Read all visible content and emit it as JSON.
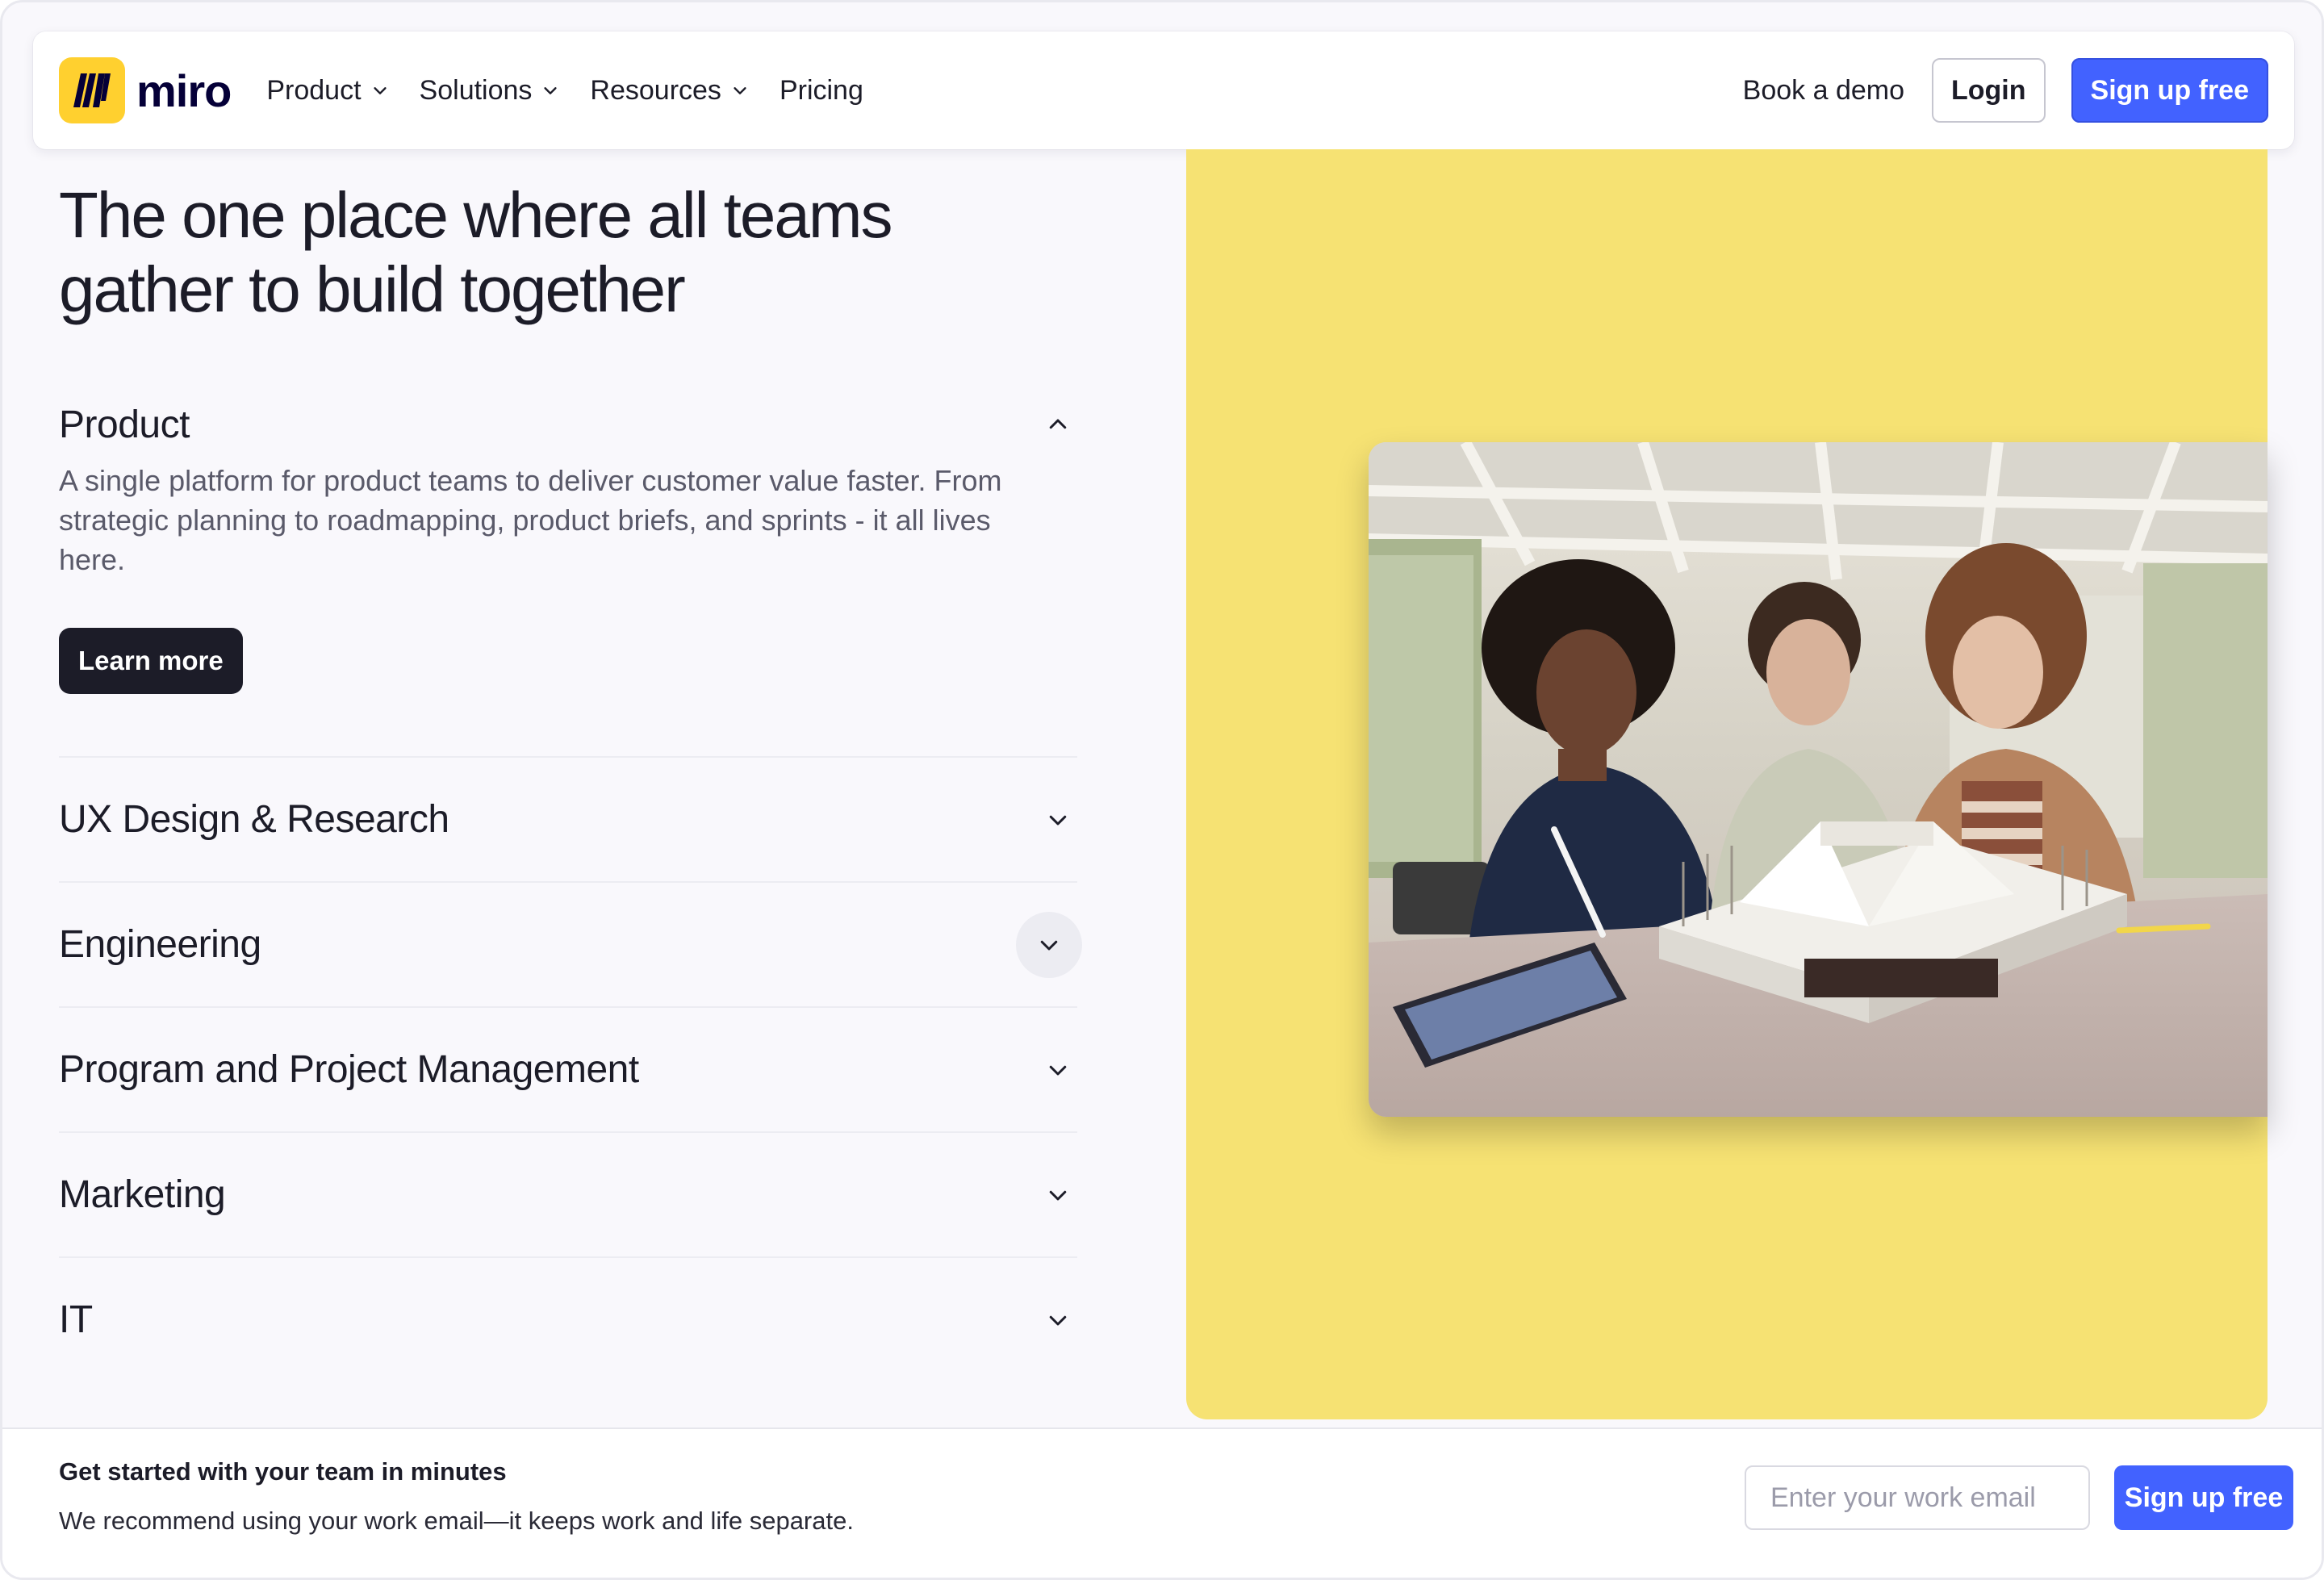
{
  "nav": {
    "logo_text": "miro",
    "links": [
      {
        "label": "Product",
        "has_dropdown": true
      },
      {
        "label": "Solutions",
        "has_dropdown": true
      },
      {
        "label": "Resources",
        "has_dropdown": true
      },
      {
        "label": "Pricing",
        "has_dropdown": false
      }
    ],
    "book_demo": "Book a demo",
    "login": "Login",
    "signup": "Sign up free"
  },
  "hero": {
    "title": "The one place where all teams gather to build together",
    "accordion": [
      {
        "title": "Product",
        "expanded": true,
        "description": "A single platform for product teams to deliver customer value faster. From strategic planning to roadmapping, product briefs, and sprints - it all lives here.",
        "button": "Learn more"
      },
      {
        "title": "UX Design & Research",
        "expanded": false
      },
      {
        "title": "Engineering",
        "expanded": false,
        "hovered": true
      },
      {
        "title": "Program and Project Management",
        "expanded": false
      },
      {
        "title": "Marketing",
        "expanded": false
      },
      {
        "title": "IT",
        "expanded": false
      }
    ],
    "panel_color": "#f6e273",
    "photo_icon": "team-collaboration-photo"
  },
  "cta": {
    "title": "Get started with your team in minutes",
    "subtitle": "We recommend using your work email—it keeps work and life separate.",
    "email_placeholder": "Enter your work email",
    "email_value": "",
    "button": "Sign up free"
  },
  "colors": {
    "brand_yellow": "#ffd02f",
    "primary_blue": "#4262ff",
    "dark": "#1c1c28"
  }
}
